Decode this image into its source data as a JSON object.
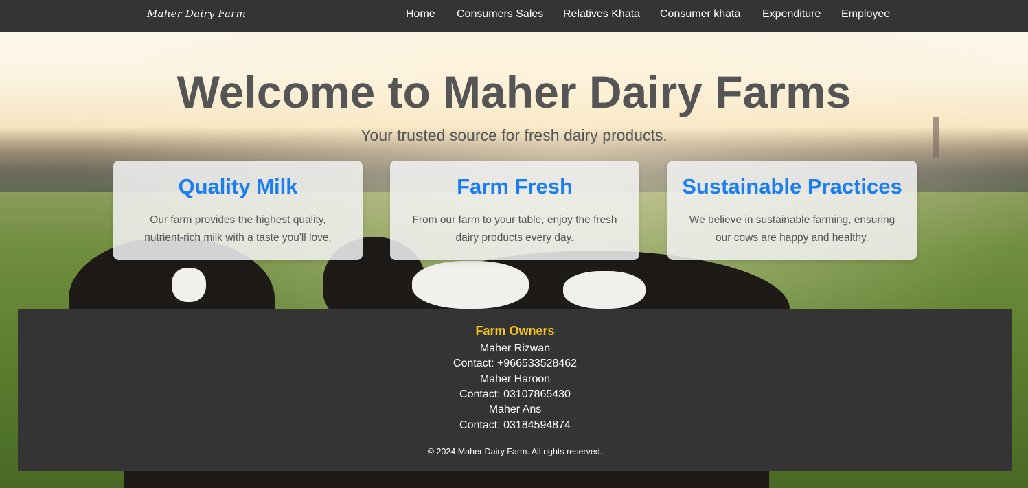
{
  "navbar": {
    "brand": "Maher Dairy Farm",
    "items": [
      {
        "label": "Home"
      },
      {
        "label": "Consumers Sales"
      },
      {
        "label": "Relatives Khata"
      },
      {
        "label": "Consumer khata"
      },
      {
        "label": "Expenditure"
      },
      {
        "label": "Employee"
      }
    ]
  },
  "hero": {
    "title": "Welcome to Maher Dairy Farms",
    "subtitle": "Your trusted source for fresh dairy products."
  },
  "cards": [
    {
      "title": "Quality Milk",
      "text": "Our farm provides the highest quality, nutrient-rich milk with a taste you'll love."
    },
    {
      "title": "Farm Fresh",
      "text": "From our farm to your table, enjoy the fresh dairy products every day."
    },
    {
      "title": "Sustainable Practices",
      "text": "We believe in sustainable farming, ensuring our cows are happy and healthy."
    }
  ],
  "footer": {
    "heading": "Farm Owners",
    "owners": [
      {
        "name": "Maher Rizwan",
        "contact": "Contact: +966533528462"
      },
      {
        "name": "Maher Haroon",
        "contact": "Contact: 03107865430"
      },
      {
        "name": "Maher Ans",
        "contact": "Contact: 03184594874"
      }
    ],
    "copyright": "© 2024 Maher Dairy Farm. All rights reserved."
  },
  "colors": {
    "navbar_bg": "#343434",
    "card_title": "#1a7ef0",
    "owners_heading": "#f5c518",
    "text_gray": "#555555"
  },
  "background": "cows-in-field-photo"
}
